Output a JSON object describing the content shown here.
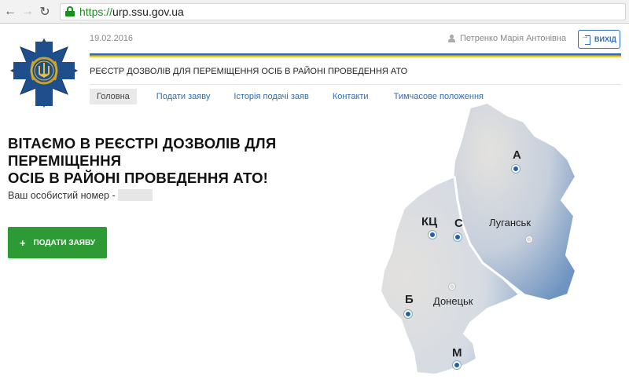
{
  "browser": {
    "url_scheme": "https://",
    "url_host": "urp.ssu.gov.ua",
    "back_icon": "arrow-left-icon",
    "forward_icon": "arrow-right-icon",
    "reload_icon": "reload-icon"
  },
  "header": {
    "date": "19.02.2016",
    "user_name": "Петренко Марія Антонівна",
    "logout_label": "ВИХІД",
    "title": "РЕЄСТР ДОЗВОЛІВ ДЛЯ ПЕРЕМІЩЕННЯ ОСІБ В РАЙОНІ ПРОВЕДЕННЯ АТО",
    "flag_colors": [
      "#2a67c4",
      "#f5c518"
    ]
  },
  "menu": {
    "items": [
      {
        "label": "Головна"
      },
      {
        "label": "Подати заяву"
      },
      {
        "label": "Історія подачі заяв"
      },
      {
        "label": "Контакти"
      },
      {
        "label": "Тимчасове положення"
      }
    ]
  },
  "main": {
    "welcome_line1": "ВІТАЄМО В РЕЄСТРІ ДОЗВОЛІВ ДЛЯ ПЕРЕМІЩЕННЯ",
    "welcome_line2": "ОСІБ В РАЙОНІ ПРОВЕДЕННЯ АТО!",
    "personal_label": "Ваш особистий номер -",
    "submit_label": "ПОДАТИ ЗАЯВУ",
    "submit_icon": "+",
    "accent_color": "#2d9b35"
  },
  "map": {
    "checkpoints": [
      "А",
      "КЦ",
      "С",
      "Б",
      "М"
    ],
    "cities": [
      "Луганськ",
      "Донецьк"
    ]
  }
}
